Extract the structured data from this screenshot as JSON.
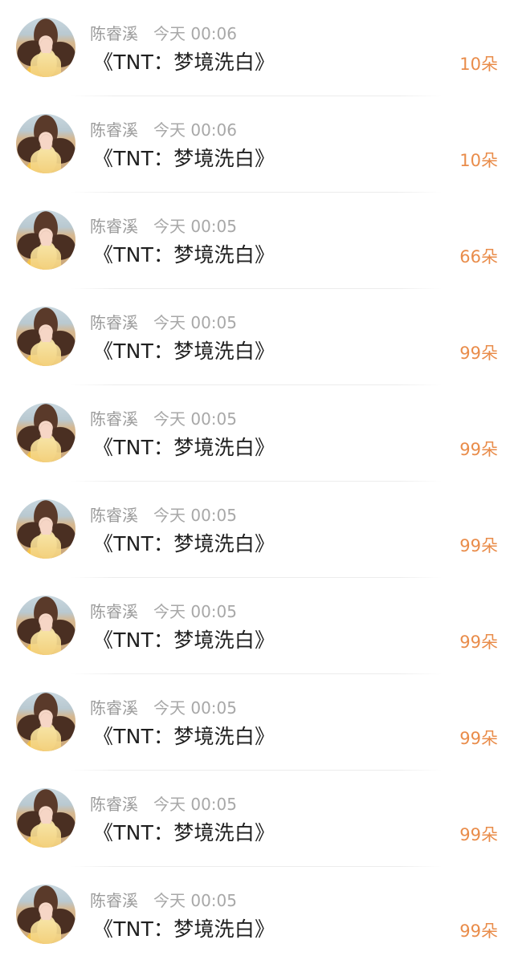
{
  "items": [
    {
      "name": "陈睿溪",
      "time": "今天 00:06",
      "title": "《TNT：梦境洗白》",
      "count": "10朵"
    },
    {
      "name": "陈睿溪",
      "time": "今天 00:06",
      "title": "《TNT：梦境洗白》",
      "count": "10朵"
    },
    {
      "name": "陈睿溪",
      "time": "今天 00:05",
      "title": "《TNT：梦境洗白》",
      "count": "66朵"
    },
    {
      "name": "陈睿溪",
      "time": "今天 00:05",
      "title": "《TNT：梦境洗白》",
      "count": "99朵"
    },
    {
      "name": "陈睿溪",
      "time": "今天 00:05",
      "title": "《TNT：梦境洗白》",
      "count": "99朵"
    },
    {
      "name": "陈睿溪",
      "time": "今天 00:05",
      "title": "《TNT：梦境洗白》",
      "count": "99朵"
    },
    {
      "name": "陈睿溪",
      "time": "今天 00:05",
      "title": "《TNT：梦境洗白》",
      "count": "99朵"
    },
    {
      "name": "陈睿溪",
      "time": "今天 00:05",
      "title": "《TNT：梦境洗白》",
      "count": "99朵"
    },
    {
      "name": "陈睿溪",
      "time": "今天 00:05",
      "title": "《TNT：梦境洗白》",
      "count": "99朵"
    },
    {
      "name": "陈睿溪",
      "time": "今天 00:05",
      "title": "《TNT：梦境洗白》",
      "count": "99朵"
    }
  ]
}
